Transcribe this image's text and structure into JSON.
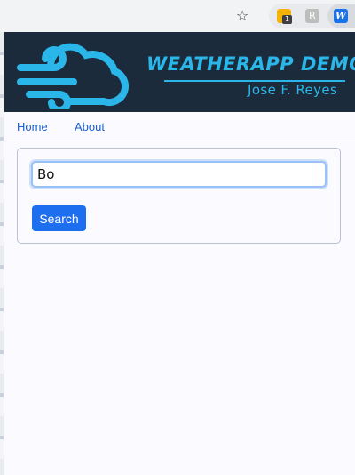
{
  "browser": {
    "star_icon": "☆",
    "extensions": [
      {
        "name": "yellow-extension-icon",
        "badge": "1"
      },
      {
        "name": "r-extension-icon",
        "label": "R"
      },
      {
        "name": "weather-extension-icon",
        "label": "W"
      }
    ]
  },
  "header": {
    "app_title": "WEATHERAPP DEMO",
    "author": "Jose F. Reyes",
    "logo_icon": "cloud-wind-icon",
    "accent_color": "#2bb6ea",
    "background_color": "#1c2b3b"
  },
  "nav": {
    "home_label": "Home",
    "about_label": "About"
  },
  "search": {
    "value": "Bo",
    "button_label": "Search",
    "button_color": "#1e6ef0"
  }
}
